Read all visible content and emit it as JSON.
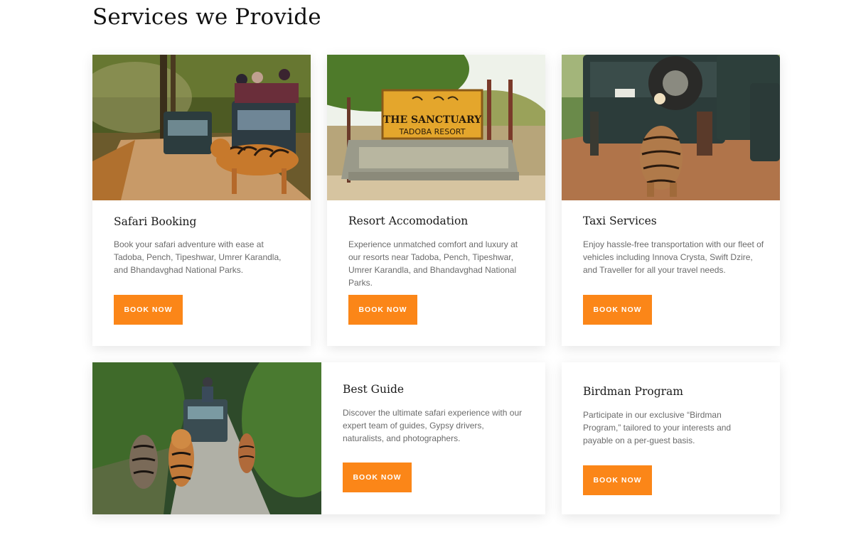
{
  "section": {
    "title": "Services we Provide"
  },
  "cards": [
    {
      "title": "Safari Booking",
      "description": "Book your safari adventure with ease at Tadoba, Pench, Tipeshwar, Umrer Karandla, and Bhandavghad National Parks.",
      "button": "BOOK NOW",
      "image_alt": "Tiger crossing a forest road in front of safari jeeps"
    },
    {
      "title": "Resort Accomodation",
      "description": "Experience unmatched comfort and luxury at our resorts near Tadoba, Pench, Tipeshwar, Umrer Karandla, and Bhandavghad National Parks.",
      "button": "BOOK NOW",
      "image_alt": "The Sanctuary Tadoba Resort wooden sign",
      "sign_line1": "THE SANCTUARY",
      "sign_line2": "TADOBA RESORT"
    },
    {
      "title": "Taxi Services",
      "description": "Enjoy hassle-free transportation with our fleet of vehicles including Innova Crysta, Swift Dzire, and Traveller for all your travel needs.",
      "button": "BOOK NOW",
      "image_alt": "Tiger walking between safari vehicles"
    },
    {
      "title": "Best Guide",
      "description": "Discover the ultimate safari experience with our expert team of guides, Gypsy drivers, naturalists, and photographers.",
      "button": "BOOK NOW",
      "image_alt": "Three tigers walking on a forest trail ahead of a jeep"
    },
    {
      "title": "Birdman Program",
      "description": "Participate in our exclusive “Birdman Program,” tailored to your interests and payable on a per-guest basis.",
      "button": "BOOK NOW"
    }
  ],
  "colors": {
    "accent": "#fb8618",
    "title": "#111111",
    "text": "#6b6b6b"
  }
}
